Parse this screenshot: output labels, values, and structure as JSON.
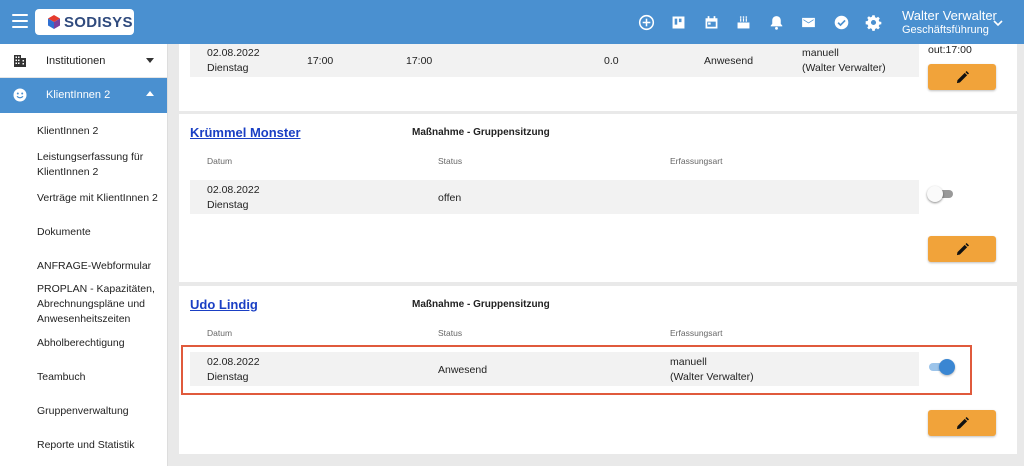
{
  "header": {
    "logo_text": "SODISYS",
    "icons": [
      "add-circle-icon",
      "board-icon",
      "calendar-icon",
      "cake-icon",
      "bell-icon",
      "mail-icon",
      "check-circle-icon",
      "gear-icon"
    ],
    "user_name": "Walter Verwalter",
    "user_role": "Geschäftsführung",
    "bar_color": "#4a90d0"
  },
  "sidebar": {
    "institutionen": "Institutionen",
    "klientinnen": "KlientInnen 2",
    "items": [
      "KlientInnen 2",
      "Leistungserfassung für KlientInnen 2",
      "Verträge mit KlientInnen 2",
      "Dokumente",
      "ANFRAGE-Webformular",
      "PROPLAN - Kapazitäten, Abrechnungspläne und Anwesenheitszeiten",
      "Abholberechtigung",
      "Teambuch",
      "Gruppenverwaltung",
      "Reporte und Statistik"
    ]
  },
  "entries": {
    "first": {
      "date": "02.08.2022",
      "weekday": "Dienstag",
      "from": "17:00",
      "to": "17:00",
      "hours": "0.0",
      "status": "Anwesend",
      "capture": "manuell",
      "capture_by": "(Walter Verwalter)",
      "out_note": "out:17:00"
    },
    "kruemmel": {
      "name": "Krümmel Monster",
      "measure": "Maßnahme - Gruppensitzung",
      "col_date": "Datum",
      "col_status": "Status",
      "col_capture": "Erfassungsart",
      "date": "02.08.2022",
      "weekday": "Dienstag",
      "status": "offen",
      "capture": "",
      "capture_by": "",
      "present": false
    },
    "udo": {
      "name": "Udo Lindig",
      "measure": "Maßnahme - Gruppensitzung",
      "col_date": "Datum",
      "col_status": "Status",
      "col_capture": "Erfassungsart",
      "date": "02.08.2022",
      "weekday": "Dienstag",
      "status": "Anwesend",
      "capture": "manuell",
      "capture_by": "(Walter Verwalter)",
      "present": true
    }
  },
  "colors": {
    "accent": "#4a90d0",
    "edit_button": "#f1a33a",
    "highlight": "#e05a3c",
    "link": "#1a3fc4"
  }
}
